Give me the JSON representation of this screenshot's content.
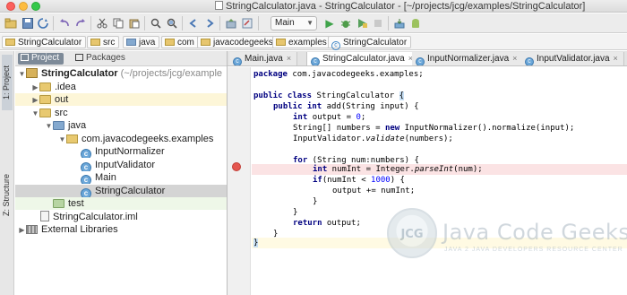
{
  "window": {
    "title": "StringCalculator.java - StringCalculator - [~/projects/jcg/examples/StringCalculator]"
  },
  "toolbar": {
    "run_config": "Main"
  },
  "breadcrumbs": [
    "StringCalculator",
    "src",
    "java",
    "com",
    "javacodegeeks",
    "examples",
    "StringCalculator"
  ],
  "left_strip": {
    "project_tab": "1: Project",
    "structure_tab": "Z: Structure"
  },
  "project_panel": {
    "tabs": [
      "Project",
      "Packages"
    ],
    "tree": [
      {
        "label": "StringCalculator",
        "suffix": " (~/projects/jcg/example",
        "icon": "project-icon"
      },
      {
        "label": ".idea",
        "icon": "folder-icon"
      },
      {
        "label": "out",
        "icon": "folder-icon"
      },
      {
        "label": "src",
        "icon": "folder-icon"
      },
      {
        "label": "java",
        "icon": "source-folder-icon"
      },
      {
        "label": "com.javacodegeeks.examples",
        "icon": "package-icon"
      },
      {
        "label": "InputNormalizer",
        "icon": "class-icon"
      },
      {
        "label": "InputValidator",
        "icon": "class-icon"
      },
      {
        "label": "Main",
        "icon": "class-icon"
      },
      {
        "label": "StringCalculator",
        "icon": "class-icon"
      },
      {
        "label": "test",
        "icon": "test-folder-icon"
      },
      {
        "label": "StringCalculator.iml",
        "icon": "iml-file-icon"
      },
      {
        "label": "External Libraries",
        "icon": "library-icon"
      }
    ]
  },
  "editor": {
    "tabs": [
      {
        "label": "Main.java",
        "active": false
      },
      {
        "label": "StringCalculator.java",
        "active": true
      },
      {
        "label": "InputNormalizer.java",
        "active": false
      },
      {
        "label": "InputValidator.java",
        "active": false
      }
    ],
    "code": [
      "package com.javacodegeeks.examples;",
      "",
      "public class StringCalculator {",
      "    public int add(String input) {",
      "        int output = 0;",
      "        String[] numbers = new InputNormalizer().normalize(input);",
      "        InputValidator.validate(numbers);",
      "",
      "        for (String num:numbers) {",
      "            int numInt = Integer.parseInt(num);",
      "            if(numInt < 1000) {",
      "                output += numInt;",
      "            }",
      "        }",
      "        return output;",
      "    }",
      "}"
    ],
    "breakpoint_line": 10
  },
  "watermark": {
    "logo_text": "JCG",
    "title": "Java Code Geeks",
    "subtitle": "JAVA 2 JAVA DEVELOPERS RESOURCE CENTER"
  },
  "colors": {
    "keyword": "#000080",
    "number": "#0000ff",
    "breakpoint": "#e4564f",
    "selection": "#d4d4d4"
  }
}
